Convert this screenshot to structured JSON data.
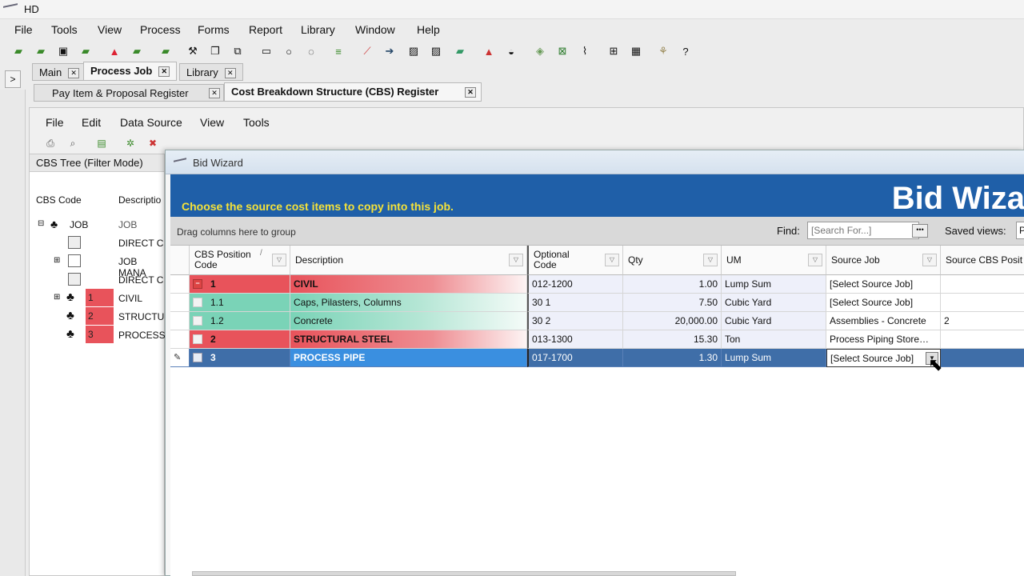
{
  "window": {
    "title": "HD"
  },
  "menu": [
    "File",
    "Tools",
    "View",
    "Process",
    "Forms",
    "Report",
    "Library",
    "Window",
    "Help"
  ],
  "toolbar_icons": [
    "open-folder-icon",
    "open-icon",
    "save-icon",
    "save-as-icon",
    "warning-icon",
    "folder-icon",
    "network-icon",
    "tools-icon",
    "document-icon",
    "hierarchy-icon",
    "mail-icon",
    "comment-icon",
    "chat-icon",
    "lines-icon",
    "chart-line-icon",
    "arrow-right-icon",
    "image-icon",
    "image-edit-icon",
    "money-icon",
    "mountain-icon",
    "cap-icon",
    "stack-icon",
    "excel-icon",
    "paperclip-icon",
    "add-icon",
    "calculator-icon",
    "wizard-icon",
    "help-icon"
  ],
  "collapse_label": ">",
  "top_tabs": [
    {
      "label": "Main"
    },
    {
      "label": "Process Job",
      "active": true
    },
    {
      "label": "Library"
    }
  ],
  "sub_tabs": [
    {
      "label": "Pay Item & Proposal Register"
    },
    {
      "label": "Cost Breakdown Structure (CBS) Register",
      "active": true
    }
  ],
  "tab_close": "✕",
  "inner_menu": [
    "File",
    "Edit",
    "Data Source",
    "View",
    "Tools"
  ],
  "cbs_panel": {
    "header": "CBS Tree (Filter Mode)",
    "col_code": "CBS Code",
    "col_desc": "Descriptio",
    "tree": [
      {
        "code": "JOB",
        "desc": "JOB"
      },
      {
        "code": "",
        "desc": "DIRECT C"
      },
      {
        "code": "",
        "desc": "JOB MANA"
      },
      {
        "code": "",
        "desc": "DIRECT C"
      },
      {
        "code": "1",
        "desc": "CIVIL"
      },
      {
        "code": "2",
        "desc": "STRUCTU"
      },
      {
        "code": "3",
        "desc": "PROCESS"
      }
    ]
  },
  "dialog": {
    "title": "Bid Wizard",
    "banner_title": "Bid Wiza",
    "banner_sub": "Choose the source cost items to copy into this job.",
    "group_hint": "Drag columns here to group",
    "find_label": "Find:",
    "find_placeholder": "[Search For...]",
    "find_button": "•••",
    "saved_views_label": "Saved views:",
    "saved_views_value": "Pr",
    "columns": [
      "CBS Position Code",
      "Description",
      "Optional Code",
      "Qty",
      "UM",
      "Source Job",
      "Source CBS Posit"
    ],
    "rows": [
      {
        "code": "1",
        "desc": "CIVIL",
        "opt": "012-1200",
        "qty": "1.00",
        "um": "Lump Sum",
        "src": "[Select Source Job]",
        "srccbs": ""
      },
      {
        "code": "1.1",
        "desc": "Caps, Pilasters, Columns",
        "opt": "30  1",
        "qty": "7.50",
        "um": "Cubic Yard",
        "src": "[Select Source Job]",
        "srccbs": ""
      },
      {
        "code": "1.2",
        "desc": "Concrete",
        "opt": "30  2",
        "qty": "20,000.00",
        "um": "Cubic Yard",
        "src": "Assemblies - Concrete",
        "srccbs": "2"
      },
      {
        "code": "2",
        "desc": "STRUCTURAL STEEL",
        "opt": "013-1300",
        "qty": "15.30",
        "um": "Ton",
        "src": "Process Piping Store…",
        "srccbs": ""
      },
      {
        "code": "3",
        "desc": "PROCESS PIPE",
        "opt": "017-1700",
        "qty": "1.30",
        "um": "Lump Sum",
        "src": "[Select Source Job]",
        "srccbs": ""
      }
    ]
  },
  "colors": {
    "banner": "#1f5fa8",
    "banner_text": "#f4e23a",
    "red": "#e8535b",
    "green": "#7ad3b7",
    "selected": "#3f6ea8"
  }
}
